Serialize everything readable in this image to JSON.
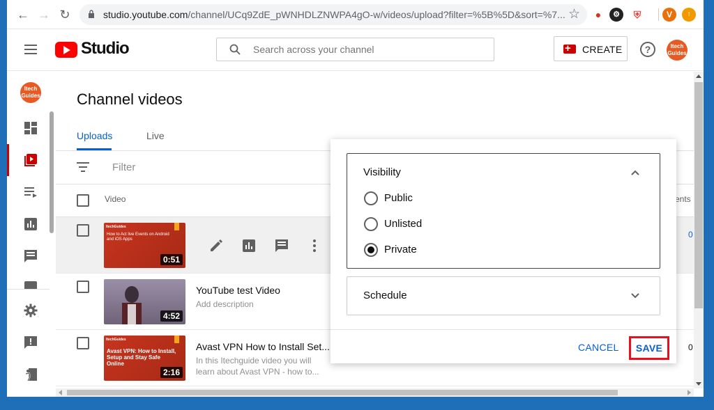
{
  "browser": {
    "url_host": "studio.youtube.com",
    "url_path": "/channel/UCq9ZdE_pWNHDLZNWPA4gO-w/videos/upload?filter=%5B%5D&sort=%7...",
    "profile_initial": "V"
  },
  "header": {
    "logo_text": "Studio",
    "search_placeholder": "Search across your channel",
    "create_label": "CREATE",
    "help_icon": "?",
    "avatar_text": "Itech Guides"
  },
  "sidebar": {
    "avatar_text": "Itech Guides",
    "items": [
      "dashboard",
      "content",
      "playlists",
      "analytics",
      "comments",
      "subtitles",
      "settings",
      "feedback",
      "classic-studio"
    ]
  },
  "main": {
    "title": "Channel videos",
    "tabs": [
      {
        "label": "Uploads"
      },
      {
        "label": "Live"
      }
    ],
    "filter_label": "Filter",
    "column_video": "Video",
    "column_comments_partial": "ents"
  },
  "videos": [
    {
      "thumb_text": "How to Act live Events on Android and iOS Apps",
      "brand": "ItechGuides",
      "duration": "0:51",
      "right_value": "0"
    },
    {
      "title": "YouTube test Video",
      "description": "Add description",
      "duration": "4:52"
    },
    {
      "title": "Avast VPN How to Install Set...",
      "description": "In this Itechguide video you will learn about Avast VPN - how to...",
      "thumb_text": "Avast VPN: How to Install, Setup and Stay Safe Online",
      "brand": "ItechGuides",
      "duration": "2:16",
      "right_value": "0"
    }
  ],
  "visibility_panel": {
    "title": "Visibility",
    "options": [
      {
        "label": "Public",
        "selected": false
      },
      {
        "label": "Unlisted",
        "selected": false
      },
      {
        "label": "Private",
        "selected": true
      }
    ],
    "schedule_title": "Schedule",
    "cancel_label": "CANCEL",
    "save_label": "SAVE"
  },
  "colors": {
    "accent": "#065fd4",
    "brand_red": "#ff0000",
    "highlight_border": "#e8101f",
    "avatar_orange": "#e85a23"
  }
}
